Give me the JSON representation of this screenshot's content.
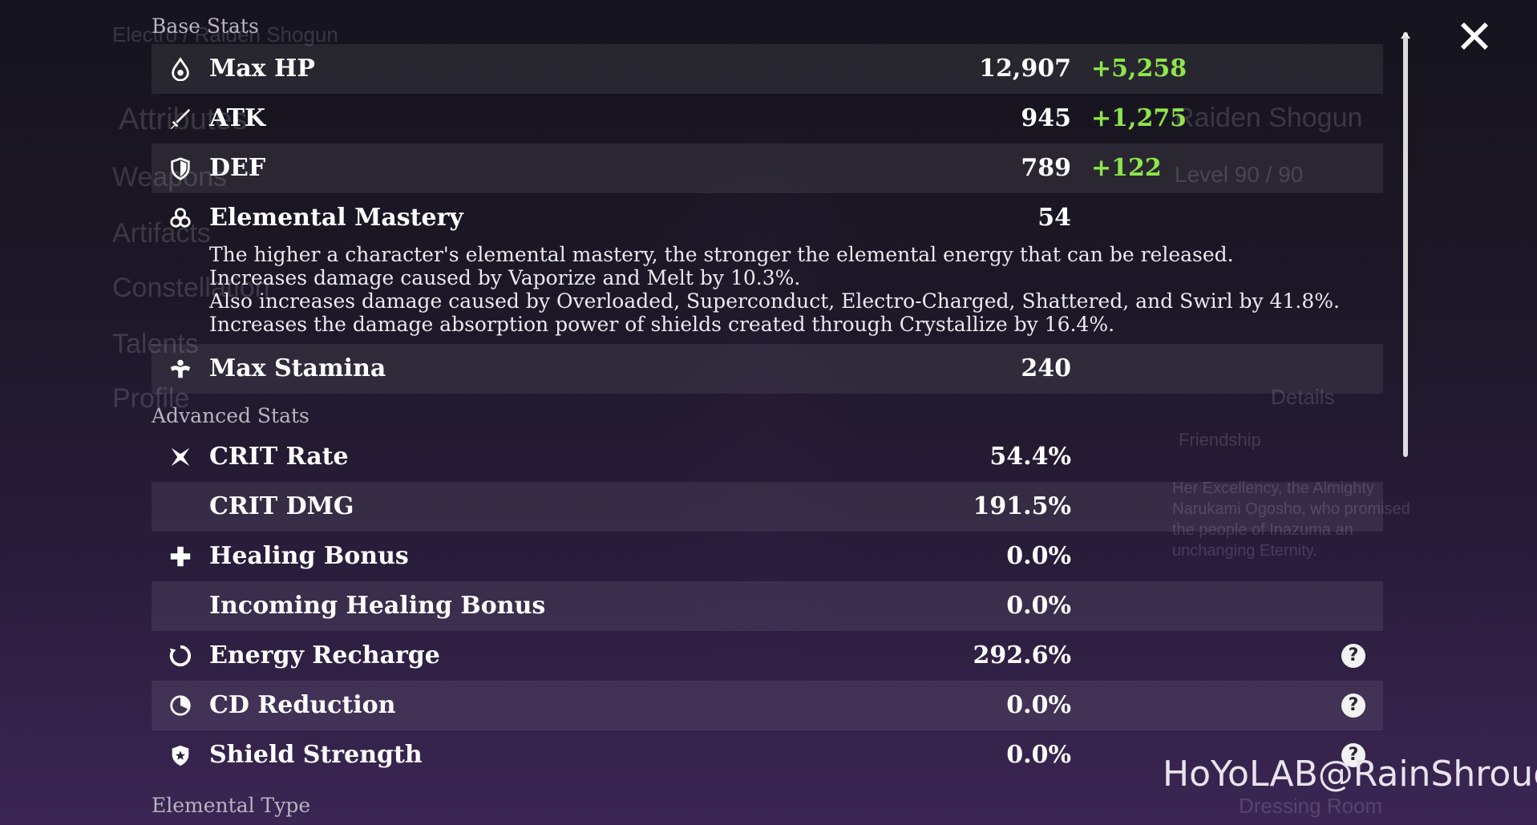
{
  "background": {
    "character_name": "Raiden Shogun",
    "header_text": "Electro / Raiden Shogun",
    "level_text": "Level 90 / 90",
    "menu_items": [
      "Attributes",
      "Weapons",
      "Artifacts",
      "Constellation",
      "Talents",
      "Profile"
    ],
    "details_label": "Details",
    "friendship_label": "Friendship",
    "dressing_room_label": "Dressing Room",
    "bio_text": "Her Excellency, the Almighty Narukami Ogosho, who promised the people of Inazuma an unchanging Eternity."
  },
  "base_stats": {
    "title": "Base Stats",
    "rows": [
      {
        "icon": "hp-drop-icon",
        "label": "Max HP",
        "value": "12,907",
        "bonus": "+5,258"
      },
      {
        "icon": "sword-icon",
        "label": "ATK",
        "value": "945",
        "bonus": "+1,275"
      },
      {
        "icon": "shield-icon",
        "label": "DEF",
        "value": "789",
        "bonus": "+122"
      },
      {
        "icon": "elemental-mastery-icon",
        "label": "Elemental Mastery",
        "value": "54",
        "bonus": ""
      }
    ],
    "em_description": [
      "The higher a character's elemental mastery, the stronger the elemental energy that can be released.",
      "Increases damage caused by Vaporize and Melt by 10.3%.",
      "Also increases damage caused by Overloaded, Superconduct, Electro-Charged, Shattered, and Swirl by 41.8%.",
      "Increases the damage absorption power of shields created through Crystallize by 16.4%."
    ],
    "stamina": {
      "icon": "stamina-icon",
      "label": "Max Stamina",
      "value": "240"
    }
  },
  "advanced_stats": {
    "title": "Advanced Stats",
    "rows": [
      {
        "icon": "crit-icon",
        "label": "CRIT Rate",
        "value": "54.4%",
        "help": false
      },
      {
        "icon": "",
        "label": "CRIT DMG",
        "value": "191.5%",
        "help": false
      },
      {
        "icon": "healing-cross-icon",
        "label": "Healing Bonus",
        "value": "0.0%",
        "help": false
      },
      {
        "icon": "",
        "label": "Incoming Healing Bonus",
        "value": "0.0%",
        "help": false
      },
      {
        "icon": "energy-recharge-icon",
        "label": "Energy Recharge",
        "value": "292.6%",
        "help": true
      },
      {
        "icon": "cd-reduction-icon",
        "label": "CD Reduction",
        "value": "0.0%",
        "help": true
      },
      {
        "icon": "shield-strength-icon",
        "label": "Shield Strength",
        "value": "0.0%",
        "help": true
      }
    ],
    "help_glyph": "?"
  },
  "elemental_type": {
    "title": "Elemental Type"
  },
  "watermark": "HoYoLAB@RainShroud",
  "colors": {
    "bonus_green": "#8ee64a",
    "section_title": "#b7b4bf",
    "row_shade": "rgba(255,255,255,0.075)"
  }
}
